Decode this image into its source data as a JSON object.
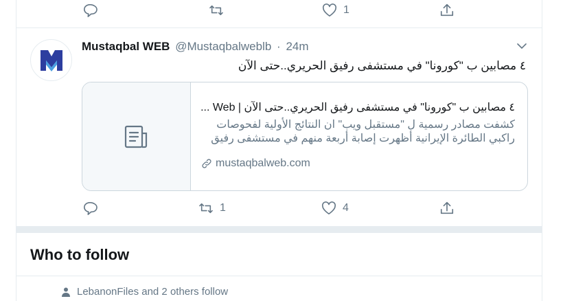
{
  "top_actions": {
    "like_count": "1"
  },
  "tweet": {
    "author_name": "Mustaqbal WEB",
    "author_handle": "@Mustaqbalweblb",
    "separator": "·",
    "time": "24m",
    "text": "٤ مصابين ب \"كورونا\" في مستشفى رفيق الحريري..حتى الآن",
    "card": {
      "title": "٤ مصابين ب \"كورونا\" في مستشفى رفيق الحريري..حتى الآن | Web ...",
      "description_line1": "كشفت مصادر رسمية ل \"مستقبل ويب\" ان النتائج الأولية لفحوصات",
      "description_line2": "راكبي الطائرة الإيرانية أظهرت إصابة أربعة منهم في مستشفى رفيق",
      "link": "mustaqbalweb.com"
    },
    "retweet_count": "1",
    "like_count": "4"
  },
  "who_to_follow": {
    "title": "Who to follow",
    "social_context": "LebanonFiles and 2 others follow"
  },
  "colors": {
    "secondary_text": "#657786",
    "border": "#e6ecf0",
    "brand_blue": "#2d3e9f"
  }
}
